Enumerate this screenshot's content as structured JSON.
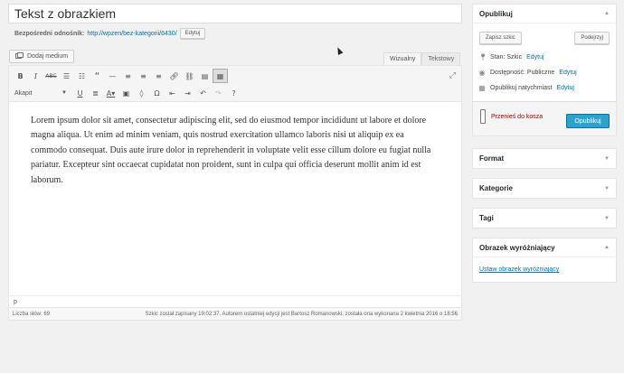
{
  "post": {
    "title": "Tekst z obrazkiem",
    "permalink_label": "Bezpośredni odnośnik:",
    "permalink_url": "http://wpzen/bez-kategorii/6430/",
    "edit_label": "Edytuj"
  },
  "editor": {
    "add_media_label": "Dodaj medium",
    "tab_visual": "Wizualny",
    "tab_text": "Tekstowy",
    "format_select": "Akapit",
    "toolbar_icons": [
      "bold-icon",
      "italic-icon",
      "strikethrough-icon",
      "bulleted-list-icon",
      "numbered-list-icon",
      "blockquote-icon",
      "horizontal-line-icon",
      "align-left-icon",
      "align-center-icon",
      "align-right-icon",
      "link-icon",
      "unlink-icon",
      "read-more-icon",
      "toolbar-toggle-icon",
      "fullscreen-icon",
      "underline-icon",
      "justify-icon",
      "text-color-icon",
      "paste-as-text-icon",
      "clear-formatting-icon",
      "special-character-icon",
      "outdent-icon",
      "indent-icon",
      "undo-icon",
      "redo-icon",
      "help-icon"
    ],
    "content": "Lorem ipsum dolor sit amet, consectetur adipiscing elit, sed do eiusmod tempor incididunt ut labore et dolore magna aliqua. Ut enim ad minim veniam, quis nostrud exercitation ullamco laboris nisi ut aliquip ex ea commodo consequat. Duis aute irure dolor in reprehenderit in voluptate velit esse cillum dolore eu fugiat nulla pariatur. Excepteur sint occaecat cupidatat non proident, sunt in culpa qui officia deserunt mollit anim id est laborum.",
    "path": "p",
    "word_count": "Liczba słów: 69",
    "status_text": "Szkic został zapisany 19:02:37. Autorem ostatniej edycji jest Bartosz Romanowski, została ona wykonana 2 kwietnia 2016 o 18:56"
  },
  "publish": {
    "title": "Opublikuj",
    "save_draft": "Zapisz szkic",
    "preview": "Podejrzyj",
    "status_label": "Stan:",
    "status_value": "Szkic",
    "visibility_label": "Dostępność:",
    "visibility_value": "Publiczne",
    "publish_time": "Opublikuj natychmiast",
    "edit_link": "Edytuj",
    "trash_label": "Przenieś do kosza",
    "publish_button": "Opublikuj"
  },
  "sidebar": {
    "format_title": "Format",
    "categories_title": "Kategorie",
    "tags_title": "Tagi",
    "featured_title": "Obrazek wyróżniający",
    "featured_link": "Ustaw obrazek wyróżniający"
  },
  "colors": {
    "link": "#0073aa",
    "primary_button": "#2ea2cc",
    "trash": "#aa0000"
  }
}
